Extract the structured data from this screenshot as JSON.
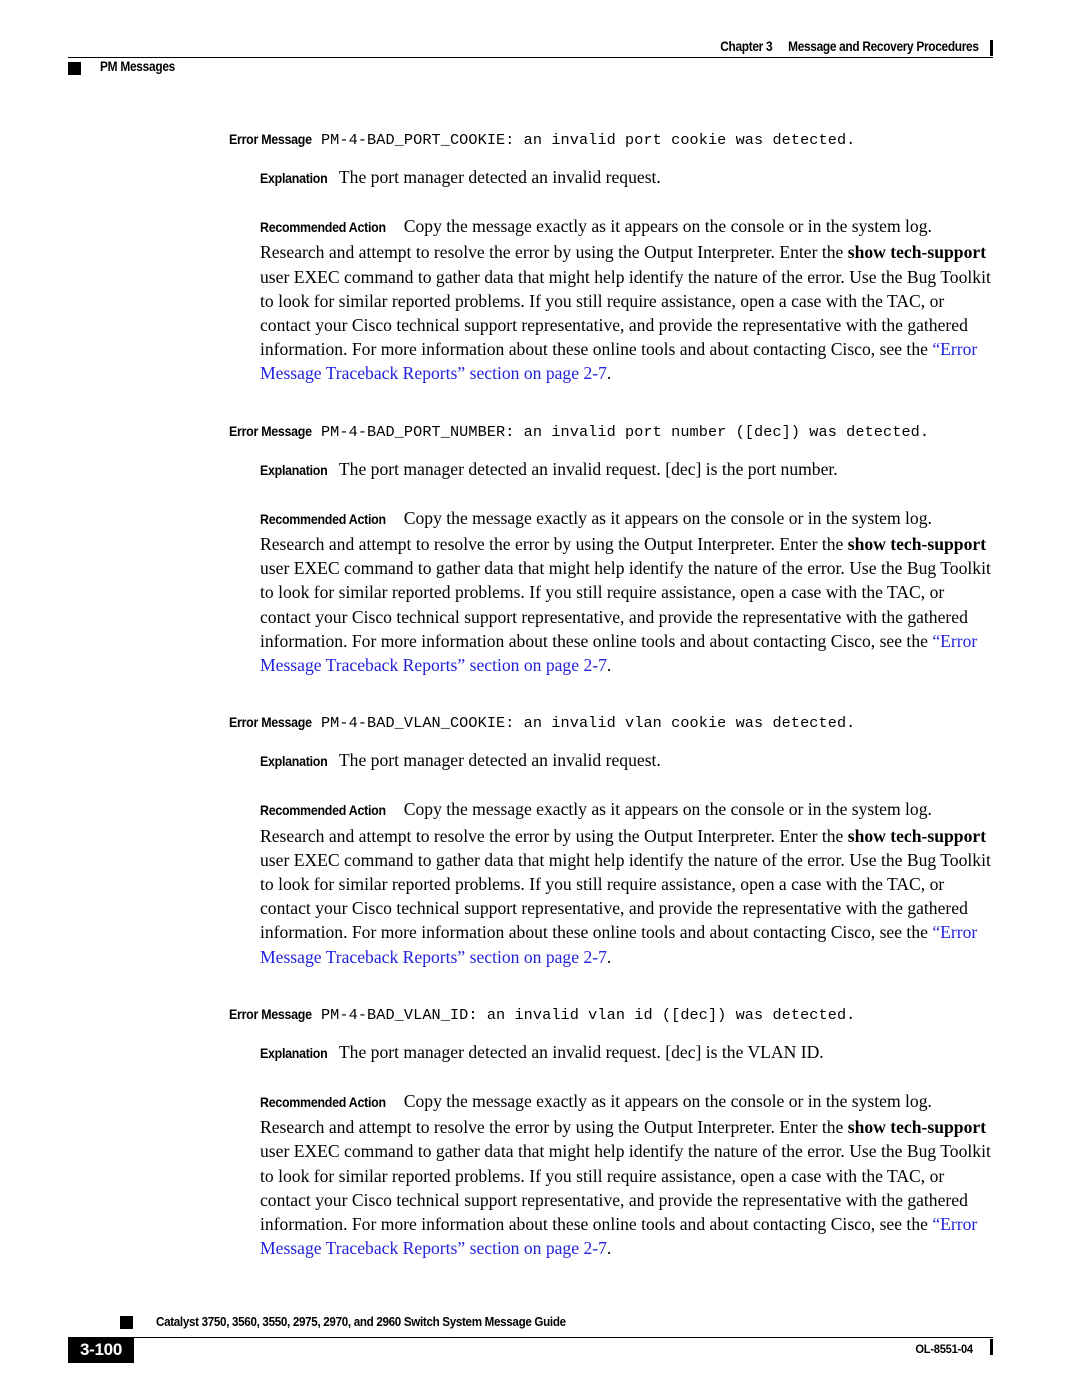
{
  "header": {
    "chapter_label": "Chapter 3",
    "chapter_title": "Message and Recovery Procedures",
    "section_label": "PM Messages"
  },
  "labels": {
    "error_message": "Error Message",
    "explanation": "Explanation",
    "recommended_action": "Recommended Action"
  },
  "messages": [
    {
      "code": "PM-4-BAD_PORT_COOKIE: an invalid port cookie was detected.",
      "explanation": "The port manager detected an invalid request.",
      "action_part1": "Copy the message exactly as it appears on the console or in the system log. Research and attempt to resolve the error by using the Output Interpreter. Enter the ",
      "action_bold1": "show tech-support",
      "action_part2": " user EXEC command to gather data that might help identify the nature of the error. Use the Bug Toolkit to look for similar reported problems. If you still require assistance, open a case with the TAC, or contact your Cisco technical support representative, and provide the representative with the gathered information. For more information about these online tools and about contacting Cisco, see the ",
      "action_link": "“Error Message Traceback Reports” section on page 2-7",
      "action_part3": "."
    },
    {
      "code": "PM-4-BAD_PORT_NUMBER: an invalid port number ([dec]) was detected.",
      "explanation": "The port manager detected an invalid request. [dec] is the port number.",
      "action_part1": "Copy the message exactly as it appears on the console or in the system log. Research and attempt to resolve the error by using the Output Interpreter. Enter the ",
      "action_bold1": "show tech-support",
      "action_part2": " user EXEC command to gather data that might help identify the nature of the error. Use the Bug Toolkit to look for similar reported problems. If you still require assistance, open a case with the TAC, or contact your Cisco technical support representative, and provide the representative with the gathered information. For more information about these online tools and about contacting Cisco, see the ",
      "action_link": "“Error Message Traceback Reports” section on page 2-7",
      "action_part3": "."
    },
    {
      "code": "PM-4-BAD_VLAN_COOKIE: an invalid vlan cookie was detected.",
      "explanation": "The port manager detected an invalid request.",
      "action_part1": "Copy the message exactly as it appears on the console or in the system log. Research and attempt to resolve the error by using the Output Interpreter. Enter the ",
      "action_bold1": "show tech-support",
      "action_part2": " user EXEC command to gather data that might help identify the nature of the error. Use the Bug Toolkit to look for similar reported problems. If you still require assistance, open a case with the TAC, or contact your Cisco technical support representative, and provide the representative with the gathered information. For more information about these online tools and about contacting Cisco, see the ",
      "action_link": "“Error Message Traceback Reports” section on page 2-7",
      "action_part3": "."
    },
    {
      "code": "PM-4-BAD_VLAN_ID: an invalid vlan id ([dec]) was detected.",
      "explanation": "The port manager detected an invalid request. [dec] is the VLAN ID.",
      "action_part1": "Copy the message exactly as it appears on the console or in the system log. Research and attempt to resolve the error by using the Output Interpreter. Enter the ",
      "action_bold1": "show tech-support",
      "action_part2": " user EXEC command to gather data that might help identify the nature of the error. Use the Bug Toolkit to look for similar reported problems. If you still require assistance, open a case with the TAC, or contact your Cisco technical support representative, and provide the representative with the gathered information. For more information about these online tools and about contacting Cisco, see the ",
      "action_link": "“Error Message Traceback Reports” section on page 2-7",
      "action_part3": "."
    }
  ],
  "footer": {
    "guide_title": "Catalyst 3750, 3560, 3550, 2975, 2970, and 2960 Switch System Message Guide",
    "page_number": "3-100",
    "doc_id": "OL-8551-04"
  },
  "colors": {
    "link": "#2222dd",
    "text": "#000000",
    "background": "#ffffff"
  }
}
